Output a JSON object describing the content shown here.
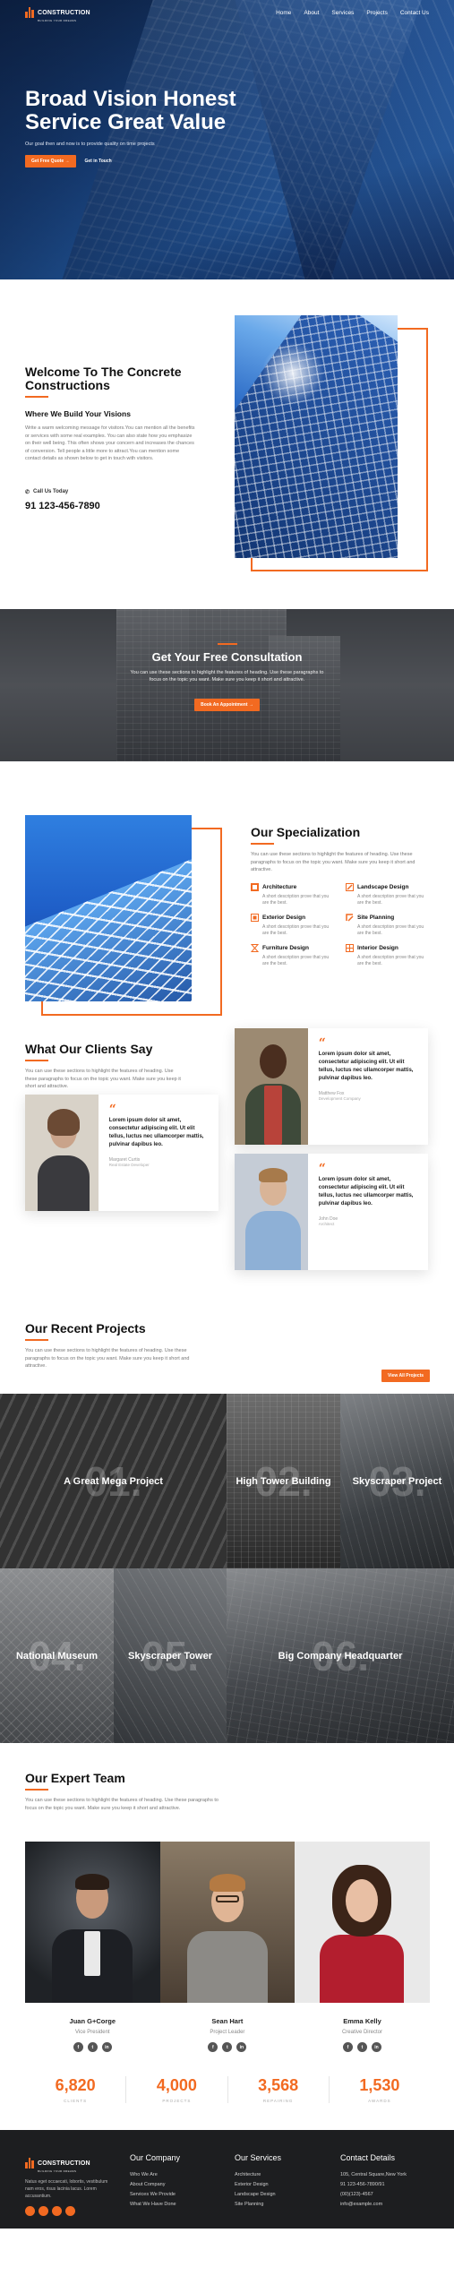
{
  "brand": {
    "name": "CONSTRUCTION",
    "tagline": "BUILDING YOUR DREAMS",
    "accent": "#f26a21"
  },
  "nav": {
    "items": [
      "Home",
      "About",
      "Services",
      "Projects",
      "Contact Us"
    ]
  },
  "hero": {
    "title": "Broad Vision Honest Service Great Value",
    "subtitle": "Our goal then and now is to provide quality on time projects",
    "primary_button": "Get Free Quote",
    "secondary_link": "Get in Touch"
  },
  "welcome": {
    "title": "Welcome To The Concrete Constructions",
    "subtitle": "Where We Build Your Visions",
    "body": "Write a warm welcoming message for visitors.You can mention all the benefits or services with some real examples. You can also state how you emphasize on their well being. This often shows your concern and increases the chances of conversion. Tell people a little more to attract.You can mention some contact details as shown below to get in touch with visitors.",
    "call_label": "Call Us Today",
    "phone": "91 123-456-7890"
  },
  "consultation": {
    "title": "Get Your Free Consultation",
    "body": "You can use these sections to highlight the features of heading. Use these paragraphs to focus on the topic you want. Make sure you keep it short and attractive.",
    "button": "Book An Appointment"
  },
  "specialization": {
    "title": "Our Specialization",
    "body": "You can use these sections to highlight the features of heading. Use these paragraphs to focus on the topic you want. Make sure you keep it short and attractive.",
    "items": [
      {
        "title": "Architecture",
        "desc": "A short description prove that you are the best.",
        "icon": "architecture-icon"
      },
      {
        "title": "Landscape Design",
        "desc": "A short description prove that you are the best.",
        "icon": "pencil-ruler-icon"
      },
      {
        "title": "Exterior Design",
        "desc": "A short description prove that you are the best.",
        "icon": "exterior-icon"
      },
      {
        "title": "Site Planning",
        "desc": "A short description prove that you are the best.",
        "icon": "site-plan-icon"
      },
      {
        "title": "Furniture Design",
        "desc": "A short description prove that you are the best.",
        "icon": "hourglass-icon"
      },
      {
        "title": "Interior Design",
        "desc": "A short description prove that you are the best.",
        "icon": "interior-icon"
      }
    ]
  },
  "testimonials": {
    "title": "What Our Clients Say",
    "body": "You can use these sections to highlight the features of heading. Use these paragraphs to focus on the topic you want. Make sure you keep it short and attractive.",
    "items": [
      {
        "text": "Lorem ipsum dolor sit amet, consectetur adipiscing elit. Ut elit tellus, luctus nec ullamcorper mattis, pulvinar dapibus leo.",
        "name": "Matthew Fox",
        "role": "Development Company"
      },
      {
        "text": "Lorem ipsum dolor sit amet, consectetur adipiscing elit. Ut elit tellus, luctus nec ullamcorper mattis, pulvinar dapibus leo.",
        "name": "Margaret Curtis",
        "role": "Real Estate Developer"
      },
      {
        "text": "Lorem ipsum dolor sit amet, consectetur adipiscing elit. Ut elit tellus, luctus nec ullamcorper mattis, pulvinar dapibus leo.",
        "name": "John Doe",
        "role": "Architect"
      }
    ]
  },
  "projects": {
    "title": "Our Recent Projects",
    "body": "You can use these sections to highlight the features of heading. Use these paragraphs to focus on the topic you want. Make sure you keep it short and attractive.",
    "button": "View All Projects",
    "items": [
      {
        "num": "01.",
        "title": "A Great Mega Project"
      },
      {
        "num": "02.",
        "title": "High Tower Building"
      },
      {
        "num": "03.",
        "title": "Skyscraper Project"
      },
      {
        "num": "04.",
        "title": "National Museum"
      },
      {
        "num": "05.",
        "title": "Skyscraper Tower"
      },
      {
        "num": "06.",
        "title": "Big Company Headquarter"
      }
    ]
  },
  "team": {
    "title": "Our Expert Team",
    "body": "You can use these sections to highlight the features of heading. Use these paragraphs to focus on the topic you want. Make sure you keep it short and attractive.",
    "members": [
      {
        "name": "Juan G+Corge",
        "role": "Vice President"
      },
      {
        "name": "Sean Hart",
        "role": "Project Leader"
      },
      {
        "name": "Emma Kelly",
        "role": "Creative Director"
      }
    ],
    "social_icons": [
      "f",
      "t",
      "in"
    ]
  },
  "stats": [
    {
      "value": "6,820",
      "label": "CLIENTS"
    },
    {
      "value": "4,000",
      "label": "PROJECTS"
    },
    {
      "value": "3,568",
      "label": "REPAIRING"
    },
    {
      "value": "1,530",
      "label": "AWARDS"
    }
  ],
  "footer": {
    "about": "Natus eget occaecati, lobortis, vestibulum nam eros, risus lacinia lacus. Lorem accusantium.",
    "company": {
      "title": "Our Company",
      "links": [
        "Who We Are",
        "About Company",
        "Services We Provide",
        "What We Have Done"
      ]
    },
    "services": {
      "title": "Our Services",
      "links": [
        "Architecture",
        "Exterior Design",
        "Landscape Design",
        "Site Planning"
      ]
    },
    "contact": {
      "title": "Contact Details",
      "lines": [
        "105, Central Square,New York",
        "91 123-456-7890/91",
        "(00)(123)-4567",
        "info@example.com"
      ]
    }
  }
}
